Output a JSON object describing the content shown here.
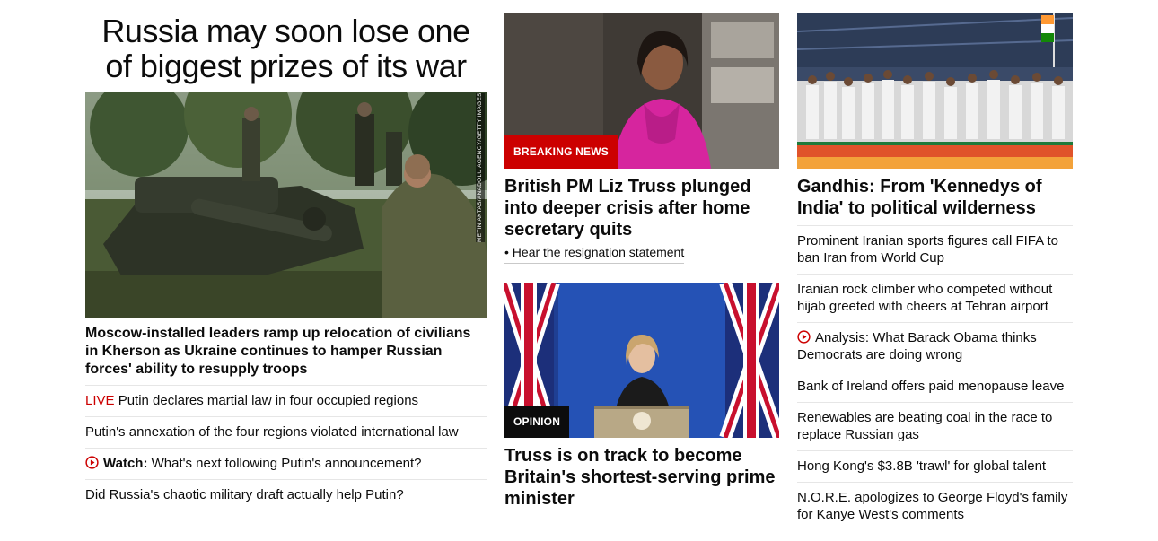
{
  "lead": {
    "banner_title": "Russia may soon lose one of biggest prizes of its war",
    "image_credit": "METIN AKTAS/ANADOLU AGENCY/GETTY IMAGES",
    "headline": "Moscow-installed leaders ramp up relocation of civilians in Kherson as Ukraine continues to hamper Russian forces' ability to resupply troops",
    "links": [
      {
        "prefix": "LIVE",
        "text": " Putin declares martial law in four occupied regions"
      },
      {
        "text": "Putin's annexation of the four regions violated international law"
      },
      {
        "icon": "play-icon",
        "bold": "Watch:",
        "text": " What's next following Putin's announcement?"
      },
      {
        "text": "Did Russia's chaotic military draft actually help Putin?"
      }
    ]
  },
  "middle": {
    "story1": {
      "tag": "BREAKING NEWS",
      "headline": "British PM Liz Truss plunged into deeper crisis after home secretary quits",
      "sub_link": "• Hear the resignation statement"
    },
    "story2": {
      "tag": "OPINION",
      "headline": "Truss is on track to become Britain's shortest-serving prime minister"
    }
  },
  "right": {
    "headline": "Gandhis: From 'Kennedys of India' to political wilderness",
    "links": [
      {
        "text": "Prominent Iranian sports figures call FIFA to ban Iran from World Cup"
      },
      {
        "text": "Iranian rock climber who competed without hijab greeted with cheers at Tehran airport"
      },
      {
        "icon": "play-icon",
        "text": "Analysis: What Barack Obama thinks Democrats are doing wrong"
      },
      {
        "text": "Bank of Ireland offers paid menopause leave"
      },
      {
        "text": "Renewables are beating coal in the race to replace Russian gas"
      },
      {
        "text": "Hong Kong's $3.8B 'trawl' for global talent"
      },
      {
        "text": "N.O.R.E. apologizes to George Floyd's family for Kanye West's comments"
      }
    ]
  },
  "colors": {
    "accent_red": "#cc0000",
    "text": "#0c0c0c",
    "divider": "#e6e6e6"
  }
}
